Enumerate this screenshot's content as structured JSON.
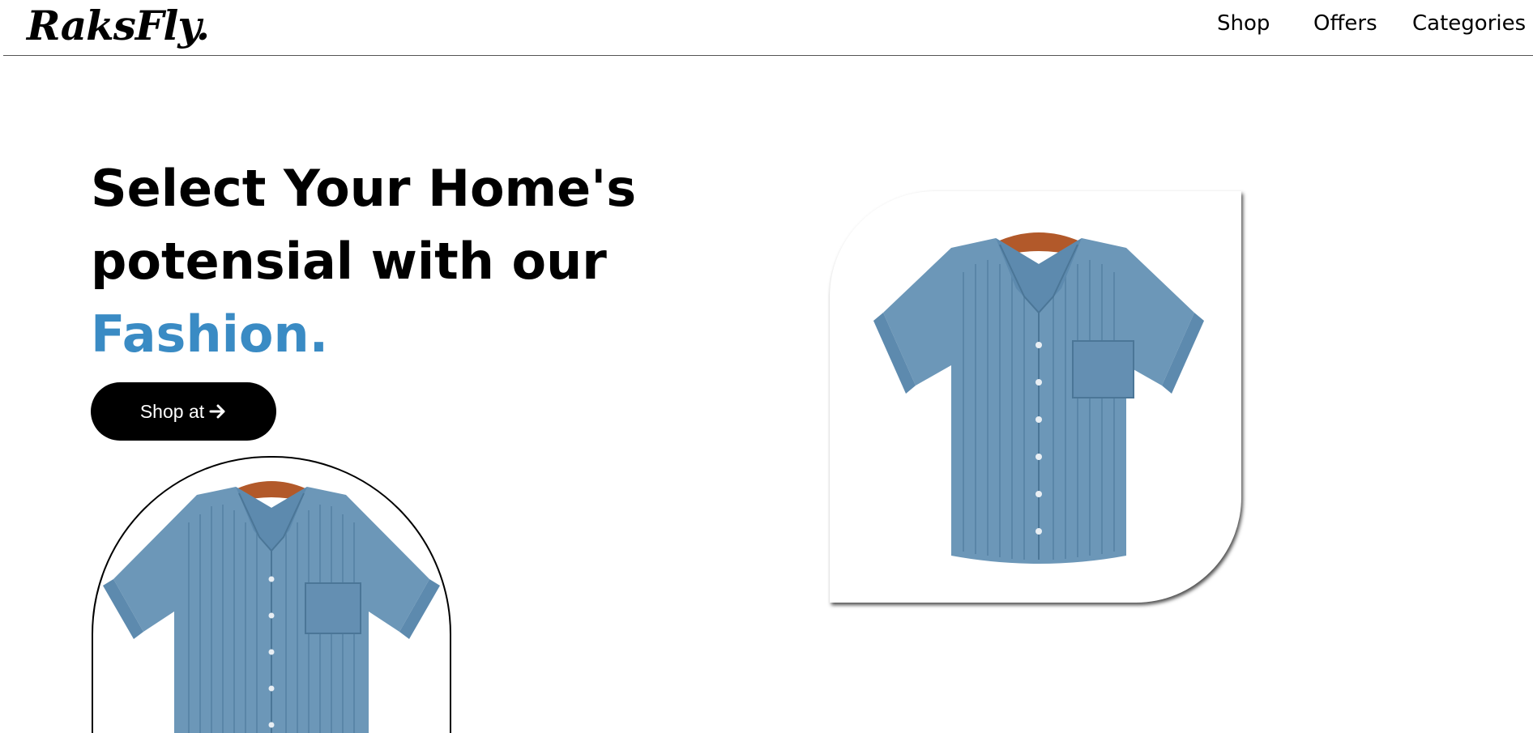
{
  "brand": {
    "logo_text": "RaksFly."
  },
  "nav": {
    "items": [
      {
        "label": "Shop"
      },
      {
        "label": "Offers"
      },
      {
        "label": "Categories"
      }
    ]
  },
  "hero": {
    "title_line1": "Select Your Home's",
    "title_line2": "potensial with our",
    "title_accent": "Fashion.",
    "accent_color": "#3a8bc4",
    "cta_label": "Shop at",
    "cta_icon": "arrow-right-icon"
  },
  "images": {
    "right": {
      "subject": "blue-shirt-on-hanger"
    },
    "bottom": {
      "subject": "blue-shirt-on-hanger"
    }
  }
}
